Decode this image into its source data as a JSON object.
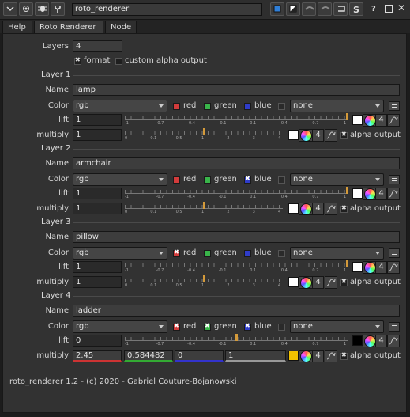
{
  "window": {
    "node_name": "roto_renderer",
    "icons": [
      "chevron-down-icon",
      "center-icon",
      "bug-icon",
      "wrench-icon"
    ],
    "right_icons": [
      "blue-square-icon",
      "half-square-icon",
      "undo-icon",
      "redo-icon",
      "revert-icon",
      "python-icon",
      "help-icon",
      "float-icon",
      "close-icon"
    ]
  },
  "tabs": [
    {
      "label": "Help"
    },
    {
      "label": "Roto Renderer"
    },
    {
      "label": "Node"
    }
  ],
  "knobs": {
    "layers_label": "Layers",
    "layers_value": "4",
    "format_label": "format",
    "custom_alpha_label": "custom alpha output"
  },
  "common": {
    "name_label": "Name",
    "color_label": "Color",
    "lift_label": "lift",
    "multiply_label": "multiply",
    "red_label": "red",
    "green_label": "green",
    "blue_label": "blue",
    "alpha_output_label": "alpha output",
    "channel_count": "4",
    "lift_ticks": [
      "-1",
      "-0.7",
      "-0.4",
      "-0.1",
      "0.1",
      "0.4",
      "0.7",
      "1"
    ],
    "mult_ticks": [
      "0",
      "0.1",
      "0.5",
      "1",
      "2",
      "3",
      "4"
    ]
  },
  "layers": [
    {
      "header": "Layer 1",
      "name": "lamp",
      "channels": "rgb",
      "red": false,
      "green": false,
      "blue": false,
      "mask": "none",
      "lift": "1",
      "lift_fraction": 1.0,
      "multiply": "1",
      "mult_fraction": 0.5,
      "lift_color": "#ffffff",
      "mult_color": "#ffffff",
      "alpha_on": true
    },
    {
      "header": "Layer 2",
      "name": "armchair",
      "channels": "rgb",
      "red": false,
      "green": false,
      "blue": true,
      "mask": "none",
      "lift": "1",
      "lift_fraction": 1.0,
      "multiply": "1",
      "mult_fraction": 0.5,
      "lift_color": "#ffffff",
      "mult_color": "#ffffff",
      "alpha_on": true
    },
    {
      "header": "Layer 3",
      "name": "pillow",
      "channels": "rgb",
      "red": true,
      "green": false,
      "blue": false,
      "mask": "none",
      "lift": "1",
      "lift_fraction": 1.0,
      "multiply": "1",
      "mult_fraction": 0.5,
      "lift_color": "#ffffff",
      "mult_color": "#ffffff",
      "alpha_on": true
    },
    {
      "header": "Layer 4",
      "name": "ladder",
      "channels": "rgb",
      "red": true,
      "green": true,
      "blue": true,
      "mask": "none",
      "lift": "0",
      "lift_fraction": 0.5,
      "multiply_values": [
        "2.45",
        "0.584482",
        "0",
        "1"
      ],
      "lift_color": "#000000",
      "mult_color": "#f2c200",
      "alpha_on": true
    }
  ],
  "footer": "roto_renderer 1.2 - (c) 2020 - Gabriel Couture-Bojanowski",
  "colors": {
    "red": "#d23b3b",
    "green": "#39b54a",
    "blue": "#2f3cc9",
    "accent": "#d49a3a"
  }
}
